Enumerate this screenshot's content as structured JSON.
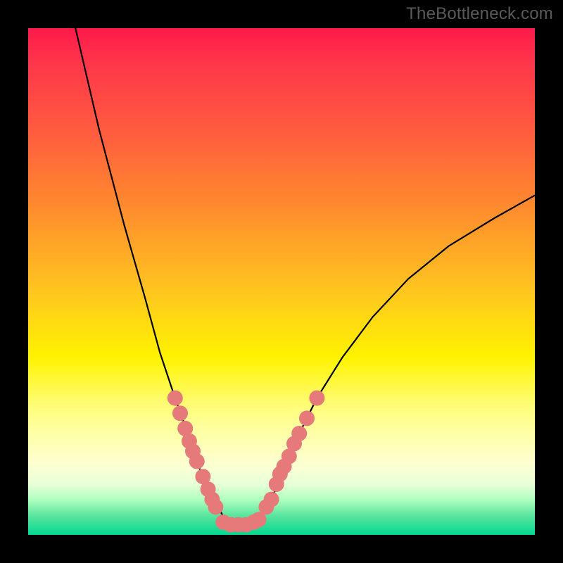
{
  "watermark": "TheBottleneck.com",
  "chart_data": {
    "type": "line",
    "title": "",
    "xlabel": "",
    "ylabel": "",
    "xlim": [
      0,
      100
    ],
    "ylim": [
      0,
      100
    ],
    "series": [
      {
        "name": "bottleneck-curve",
        "x": [
          0,
          7,
          14,
          19,
          23,
          26,
          29,
          31.5,
          33.5,
          35,
          36.5,
          38,
          39,
          40.5,
          42,
          44,
          46,
          48,
          50,
          53,
          57,
          62,
          68,
          75,
          83,
          92,
          100
        ],
        "y": [
          146,
          110,
          80,
          61,
          47,
          36,
          27,
          20,
          14,
          10,
          7,
          4.5,
          3,
          2,
          2,
          2,
          3.5,
          7,
          12,
          19,
          27,
          35,
          43,
          50.5,
          57,
          62.5,
          67
        ],
        "color": "#000000"
      }
    ],
    "markers": [
      {
        "name": "left-branch-markers",
        "x": [
          29,
          30,
          31,
          31.8,
          32.5,
          33.3,
          34.5,
          35.5,
          36.3,
          37
        ],
        "y": [
          27,
          24,
          21,
          18.5,
          16.5,
          14.5,
          11.5,
          9,
          7,
          5.5
        ],
        "color": "#e67a7a",
        "size": 11
      },
      {
        "name": "right-branch-markers",
        "x": [
          45.5,
          47,
          48,
          49,
          49.7,
          50.5,
          51.5,
          52.5,
          53.5,
          55,
          57
        ],
        "y": [
          3,
          5.5,
          7,
          10,
          12,
          13.5,
          15.5,
          18,
          20,
          23,
          27
        ],
        "color": "#e67a7a",
        "size": 11
      },
      {
        "name": "bottom-markers",
        "x": [
          38.5,
          40,
          41.5,
          43,
          44.5
        ],
        "y": [
          2.5,
          2,
          2,
          2,
          2.5
        ],
        "color": "#e67a7a",
        "size": 11
      }
    ],
    "gradient_stops": [
      {
        "pos": 0,
        "color": "#ff1a4a"
      },
      {
        "pos": 20,
        "color": "#ff5a3f"
      },
      {
        "pos": 50,
        "color": "#ffc61f"
      },
      {
        "pos": 70,
        "color": "#fff300"
      },
      {
        "pos": 88,
        "color": "#fdffd0"
      },
      {
        "pos": 100,
        "color": "#00d890"
      }
    ]
  }
}
